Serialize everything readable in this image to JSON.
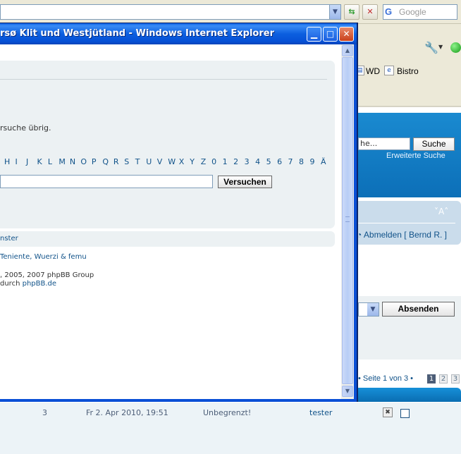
{
  "popup": {
    "title": "rsø Klit und Westjütland - Windows Internet Explorer",
    "description": "rsuche übrig.",
    "letters": [
      "H",
      "I",
      "J",
      "K",
      "L",
      "M",
      "N",
      "O",
      "P",
      "Q",
      "R",
      "S",
      "T",
      "U",
      "V",
      "W",
      "X",
      "Y",
      "Z",
      "0",
      "1",
      "2",
      "3",
      "4",
      "5",
      "6",
      "7",
      "8",
      "9",
      "Ä"
    ],
    "try_button": "Versuchen",
    "footer_link": "nster",
    "online_users": "Teniente, Wuerzi & femu",
    "copyright_line1": ", 2005, 2007 phpBB Group",
    "copyright_line2_prefix": " durch ",
    "copyright_link": "phpBB.de",
    "minimize_glyph": "▁",
    "maximize_glyph": "□",
    "close_glyph": "✕",
    "scroll_up": "▲",
    "scroll_down": "▼"
  },
  "browser": {
    "search_placeholder": "Google",
    "search_logo": "G",
    "addr_dropdown": "▼",
    "refresh_glyph": "⇆",
    "stop_glyph": "✕",
    "tools_glyph": "🔧",
    "tools_dropdown": "▼",
    "favorites": [
      {
        "icon": "▤",
        "label": "WD"
      },
      {
        "icon": "e",
        "label": "Bistro"
      }
    ]
  },
  "background_page": {
    "search_input_value": "he...",
    "search_button": "Suche",
    "advanced_search": "Erweiterte Suche",
    "font_size_controls": "˅A˄",
    "logout": "Abmelden [ Bernd R. ]",
    "logout_icon": "◔",
    "select_dropdown": "▼",
    "submit_button": "Absenden",
    "pagination_text": "• Seite 1 von 3 •",
    "pages": [
      "1",
      "2",
      "3"
    ],
    "row": {
      "count": "3",
      "date": "Fr 2. Apr 2010, 19:51",
      "duration": "Unbegrenzt!",
      "user": "tester",
      "delete_glyph": "✖"
    }
  },
  "colors": {
    "titlebar": "#0a5fe6",
    "link": "#105289",
    "panel": "#ecf1f3"
  }
}
